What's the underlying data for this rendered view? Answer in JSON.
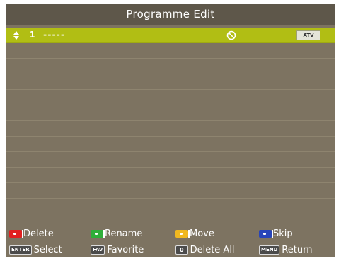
{
  "title": "Programme Edit",
  "channel_list": [
    {
      "number": "1",
      "name": "-----",
      "skip_icon": "skip-icon",
      "type": "ATV",
      "selected": true
    },
    {
      "number": "",
      "name": "",
      "selected": false
    },
    {
      "number": "",
      "name": "",
      "selected": false
    },
    {
      "number": "",
      "name": "",
      "selected": false
    },
    {
      "number": "",
      "name": "",
      "selected": false
    },
    {
      "number": "",
      "name": "",
      "selected": false
    },
    {
      "number": "",
      "name": "",
      "selected": false
    },
    {
      "number": "",
      "name": "",
      "selected": false
    },
    {
      "number": "",
      "name": "",
      "selected": false
    },
    {
      "number": "",
      "name": "",
      "selected": false
    },
    {
      "number": "",
      "name": "",
      "selected": false
    },
    {
      "number": "",
      "name": "",
      "selected": false
    }
  ],
  "legend": {
    "delete": {
      "label": "Delete",
      "key_color": "#e02020",
      "icon": "red-key-icon"
    },
    "rename": {
      "label": "Rename",
      "key_color": "#2fae3a",
      "icon": "green-key-icon"
    },
    "move": {
      "label": "Move",
      "key_color": "#f0b820",
      "icon": "yellow-key-icon"
    },
    "skip": {
      "label": "Skip",
      "key_color": "#2845b8",
      "icon": "blue-key-icon"
    },
    "select": {
      "label": "Select",
      "key_text": "ENTER"
    },
    "favorite": {
      "label": "Favorite",
      "key_text": "FAV"
    },
    "delete_all": {
      "label": "Delete All",
      "key_text": "0"
    },
    "return": {
      "label": "Return",
      "key_text": "MENU"
    }
  },
  "colors": {
    "background": "#7d7361",
    "title_bar": "#5e574a",
    "highlight": "#b1be14"
  }
}
